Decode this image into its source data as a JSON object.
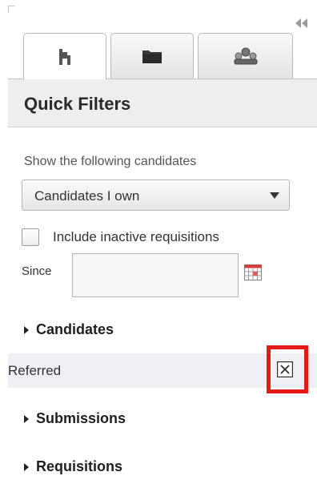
{
  "panel": {
    "collapse_icon": "double-chevron-left-icon",
    "accent_color": "#e51919"
  },
  "tabs": [
    {
      "icon": "person-icon",
      "active": true
    },
    {
      "icon": "folder-icon",
      "active": false
    },
    {
      "icon": "group-icon",
      "active": false
    }
  ],
  "header": {
    "title": "Quick Filters"
  },
  "filters": {
    "show_label": "Show the following candidates",
    "owner_select": {
      "value": "Candidates I own"
    },
    "include_inactive": {
      "label": "Include inactive requisitions",
      "checked": false
    },
    "since": {
      "label": "Since",
      "value": ""
    }
  },
  "sections": {
    "candidates": "Candidates",
    "submissions": "Submissions",
    "requisitions": "Requisitions"
  },
  "active_filter": {
    "label": "Referred",
    "remove_icon": "remove-x-icon"
  }
}
